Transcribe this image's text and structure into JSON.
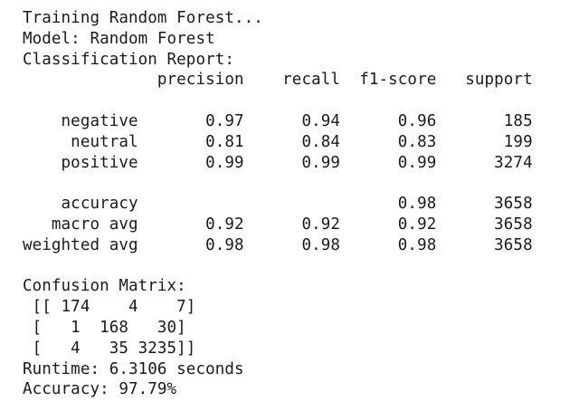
{
  "output": {
    "lines": [
      "Training Random Forest...",
      "Model: Random Forest",
      "Classification Report:",
      "              precision    recall  f1-score   support",
      "",
      "    negative       0.97      0.94      0.96       185",
      "     neutral       0.81      0.84      0.83       199",
      "    positive       0.99      0.99      0.99      3274",
      "",
      "    accuracy                           0.98      3658",
      "   macro avg       0.92      0.92      0.92      3658",
      "weighted avg       0.98      0.98      0.98      3658",
      "",
      "Confusion Matrix:",
      " [[ 174    4    7]",
      " [   1  168   30]",
      " [   4   35 3235]]",
      "Runtime: 6.3106 seconds",
      "Accuracy: 97.79%"
    ]
  }
}
